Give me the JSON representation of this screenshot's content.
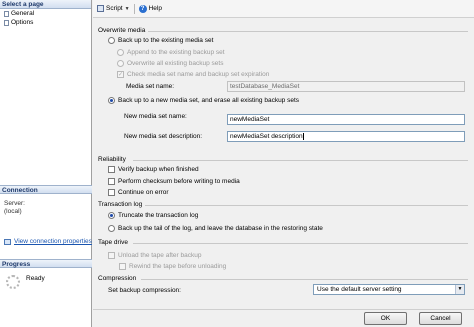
{
  "sidebar": {
    "select_page_header": "Select a page",
    "pages": [
      {
        "label": "General"
      },
      {
        "label": "Options"
      }
    ],
    "connection_header": "Connection",
    "server_label": "Server:",
    "server_value": "(local)",
    "view_connection_link": "View connection properties",
    "progress_header": "Progress",
    "progress_status": "Ready"
  },
  "toolbar": {
    "script_label": "Script",
    "help_label": "Help"
  },
  "overwrite_media": {
    "title": "Overwrite media",
    "backup_existing_label": "Back up to the existing media set",
    "append_label": "Append to the existing backup set",
    "overwrite_all_label": "Overwrite all existing backup sets",
    "check_name_label": "Check media set name and backup set expiration",
    "media_set_name_label": "Media set name:",
    "media_set_name_value": "testDatabase_MediaSet",
    "new_media_set_label": "Back up to a new media set, and erase all existing backup sets",
    "new_name_label": "New media set name:",
    "new_name_value": "newMediaSet",
    "new_desc_label": "New media set description:",
    "new_desc_value": "newMediaSet description"
  },
  "reliability": {
    "title": "Reliability",
    "verify_label": "Verify backup when finished",
    "checksum_label": "Perform checksum before writing to media",
    "continue_label": "Continue on error"
  },
  "transaction_log": {
    "title": "Transaction log",
    "truncate_label": "Truncate the transaction log",
    "tail_label": "Back up the tail of the log, and leave the database in the restoring state"
  },
  "tape_drive": {
    "title": "Tape drive",
    "unload_label": "Unload the tape after backup",
    "rewind_label": "Rewind the tape before unloading"
  },
  "compression": {
    "title": "Compression",
    "set_label": "Set backup compression:",
    "selected_value": "Use the default server setting"
  },
  "footer": {
    "ok_label": "OK",
    "cancel_label": "Cancel"
  },
  "colors": {
    "accent": "#1d49a8",
    "header_text": "#1f3a6b",
    "link": "#1a55b0"
  }
}
